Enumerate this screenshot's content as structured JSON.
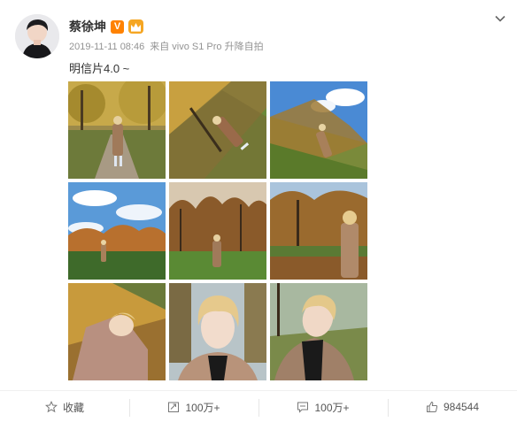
{
  "post": {
    "username": "蔡徐坤",
    "verified_badge": "V",
    "timestamp": "2019-11-11 08:46",
    "source_prefix": "来自",
    "source_device": "vivo S1 Pro 升降自拍",
    "text": "明信片4.0 ~"
  },
  "photos": [
    {
      "scene": "autumn-path-walking"
    },
    {
      "scene": "tilted-tree-lying"
    },
    {
      "scene": "tilted-blue-sky"
    },
    {
      "scene": "blue-sky-park-small-figure"
    },
    {
      "scene": "park-standing-center"
    },
    {
      "scene": "park-standing-right"
    },
    {
      "scene": "tilted-portrait-leaves"
    },
    {
      "scene": "selfie-close-up"
    },
    {
      "scene": "selfie-tilted-park"
    }
  ],
  "toolbar": {
    "favorite_label": "收藏",
    "repost_count": "100万+",
    "comment_count": "100万+",
    "like_count": "984544"
  },
  "colors": {
    "accent_orange": "#ff8200",
    "meta_gray": "#939393",
    "sky_blue": "#4a90d9",
    "autumn_gold": "#c89b3c"
  }
}
